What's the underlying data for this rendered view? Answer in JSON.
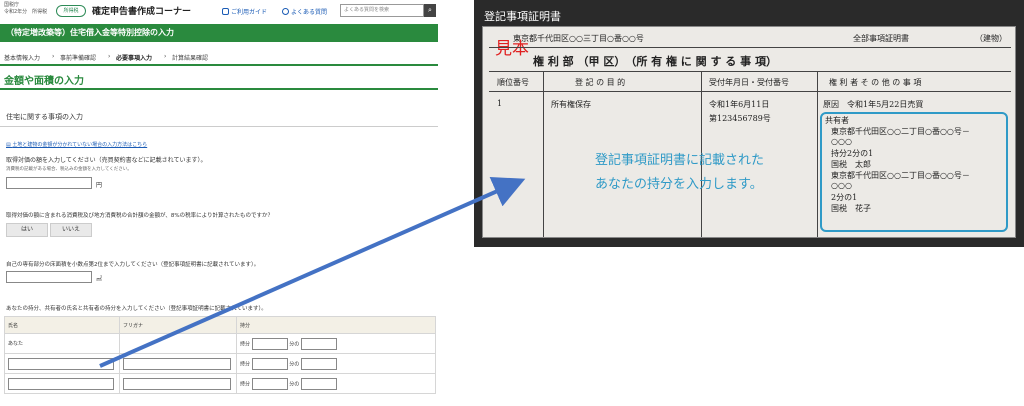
{
  "header": {
    "era_line1": "国税庁",
    "era_line2": "令和2年分　所得税",
    "badge": "所得税",
    "app_title": "確定申告書作成コーナー",
    "guide_link": "ご利用ガイド",
    "faq_link": "よくある質問",
    "search_placeholder": "よくある質問を検索"
  },
  "section_band": "（特定増改築等）住宅借入金等特別控除の入力",
  "breadcrumbs": [
    "基本情報入力",
    "事前準備確認",
    "必要事項入力",
    "計算結果確認"
  ],
  "page_title": "金額や面積の入力",
  "form": {
    "section_title": "住宅に関する事項の入力",
    "help_link": "土地と建物の金額が分かれていない場合の入力方法はこちら",
    "q1": "取得対価の額を入力してください（売買契約書などに記載されています）。",
    "q1_note": "消費税の記載がある場合、税込みの金額を入力してください。",
    "q1_unit": "円",
    "q2": "取得対価の額に含まれる消費税及び地方消費税の合計額の金額が、8%の税率により計算されたものですか？",
    "yes": "はい",
    "no": "いいえ",
    "q3": "自己の専有部分の床面積を小数点第2位まで入力してください（登記事項証明書に記載されています）。",
    "q3_unit": "㎡",
    "q4": "あなたの持分、共有者の氏名と共有者の持分を入力してください（登記事項証明書に記載されています）。",
    "table": {
      "headers": [
        "氏名",
        "フリガナ",
        "持分"
      ],
      "row1_name": "あなた",
      "share_label": "持分",
      "bun_no": "分の"
    }
  },
  "certificate": {
    "panel_title": "登記事項証明書",
    "address_top": "東京都千代田区○○三丁目○番○○号",
    "doc_title": "全部事項証明書",
    "doc_type": "（建物）",
    "sample_mark": "見本",
    "section_heading": "権 利 部 （甲 区）　（所 有 権 に 関 す る 事 項）",
    "col_headers": [
      "順位番号",
      "登 記 の 目 的",
      "受付年月日・受付番号",
      "権 利 者 そ の 他 の 事 項"
    ],
    "rank": "1",
    "purpose": "所有権保存",
    "receipt_date": "令和1年6月11日",
    "receipt_no": "第123456789号",
    "cause": "原因　令和1年5月22日売買",
    "owners_label": "共有者",
    "owner1_addr1": "東京都千代田区○○二丁目○番○○号－",
    "owner1_addr2": "○○○",
    "owner1_share": "持分2分の1",
    "owner1_name": "国税　太郎",
    "owner2_addr1": "東京都千代田区○○二丁目○番○○号－",
    "owner2_addr2": "○○○",
    "owner2_share": "2分の1",
    "owner2_name": "国税　花子",
    "caption_line1": "登記事項証明書に記載された",
    "caption_line2": "あなたの持分を入力します。"
  },
  "colors": {
    "brand_green": "#2a8a3e",
    "link_blue": "#1a5bb5",
    "highlight_blue": "#2f9ac7",
    "arrow_blue": "#4472c4",
    "sample_red": "#e02020"
  }
}
